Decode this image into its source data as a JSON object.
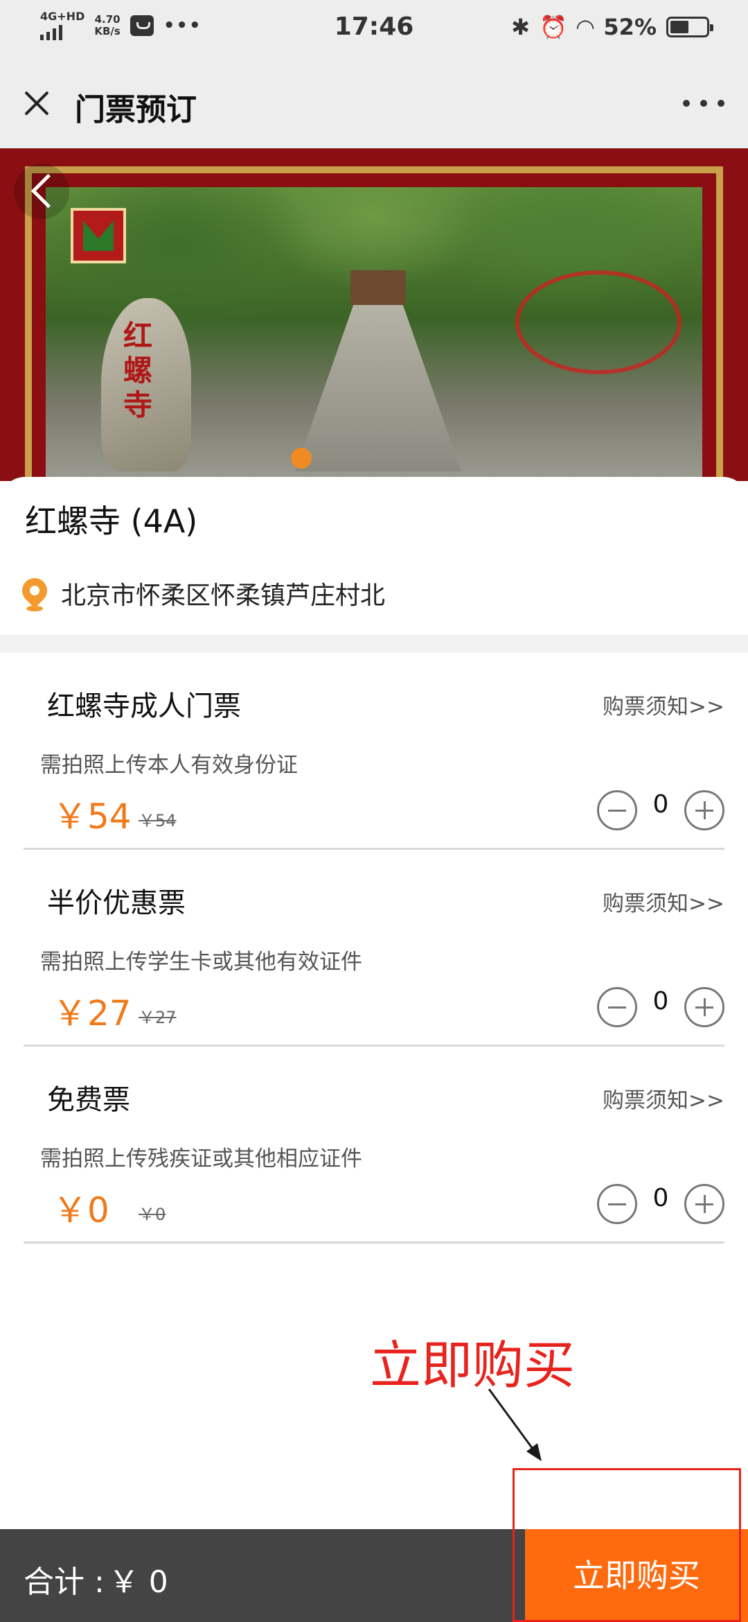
{
  "status_bar": {
    "network": "4G+HD",
    "speed_value": "4.70",
    "speed_unit": "KB/s",
    "time": "17:46",
    "battery": "52%"
  },
  "header": {
    "title": "门票预订"
  },
  "banner": {
    "rock_text": "红螺寺"
  },
  "place": {
    "name": "红螺寺 (4A)",
    "address": "北京市怀柔区怀柔镇芦庄村北"
  },
  "tickets": [
    {
      "name": "红螺寺成人门票",
      "notice": "购票须知>>",
      "desc": "需拍照上传本人有效身份证",
      "price": "￥54",
      "original_price": "￥54",
      "quantity": "0"
    },
    {
      "name": "半价优惠票",
      "notice": "购票须知>>",
      "desc": "需拍照上传学生卡或其他有效证件",
      "price": "￥27",
      "original_price": "￥27",
      "quantity": "0"
    },
    {
      "name": "免费票",
      "notice": "购票须知>>",
      "desc": "需拍照上传残疾证或其他相应证件",
      "price": "￥0",
      "original_price": "￥0",
      "quantity": "0"
    }
  ],
  "annotation": {
    "text": "立即购买",
    "color": "#e8231d"
  },
  "footer": {
    "total_label": "合计 :",
    "total_value": "￥ 0",
    "buy_label": "立即购买"
  },
  "colors": {
    "accent": "#ff6a0f",
    "price": "#f07a1a",
    "footer_bg": "#444444"
  }
}
